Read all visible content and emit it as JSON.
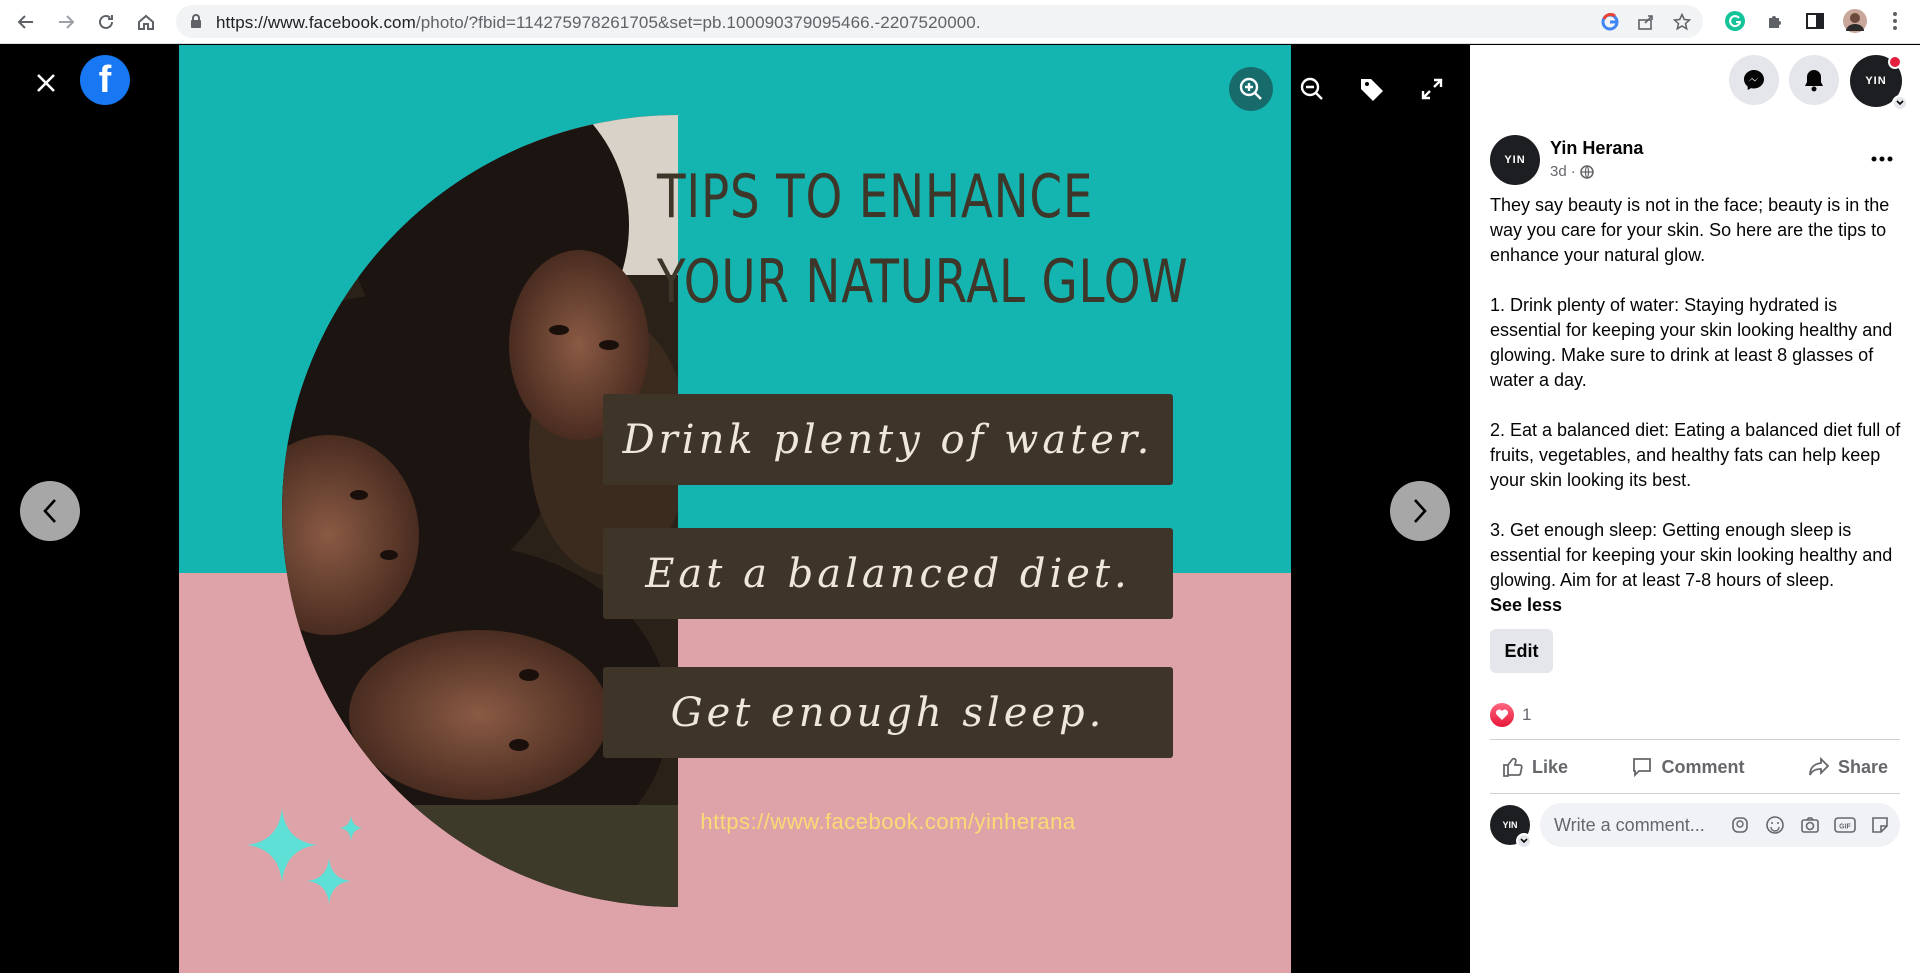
{
  "browser": {
    "url_host": "https://www.facebook.com",
    "url_path": "/photo/?fbid=114275978261705&set=pb.100090379095466.-2207520000."
  },
  "photo": {
    "headline_line1": "TIPS TO ENHANCE",
    "headline_line2": "YOUR NATURAL GLOW",
    "tips": [
      "Drink plenty of water.",
      "Eat a balanced diet.",
      "Get enough sleep."
    ],
    "link": "https://www.facebook.com/yinherana",
    "colors": {
      "teal": "#14b5b0",
      "pink": "#dea3a8",
      "box": "#3e3528",
      "link": "#fadb76"
    }
  },
  "post": {
    "author": "Yin Herana",
    "time": "3d",
    "avatar_text": "YIN",
    "paragraphs": [
      "They say beauty is not in the face; beauty is in the way you care for your skin. So here are the tips to enhance your natural glow.",
      "1. Drink plenty of water: Staying hydrated is essential for keeping your skin looking healthy and glowing. Make sure to drink at least 8 glasses of water a day.",
      "2. Eat a balanced diet: Eating a balanced diet full of fruits, vegetables, and healthy fats can help keep your skin looking its best.",
      "3. Get enough sleep: Getting enough sleep is essential for keeping your skin looking healthy and glowing. Aim for at least 7-8 hours of sleep."
    ],
    "see_less": "See less",
    "edit": "Edit",
    "reaction_count": "1",
    "actions": {
      "like": "Like",
      "comment": "Comment",
      "share": "Share"
    },
    "comment_placeholder": "Write a comment..."
  }
}
